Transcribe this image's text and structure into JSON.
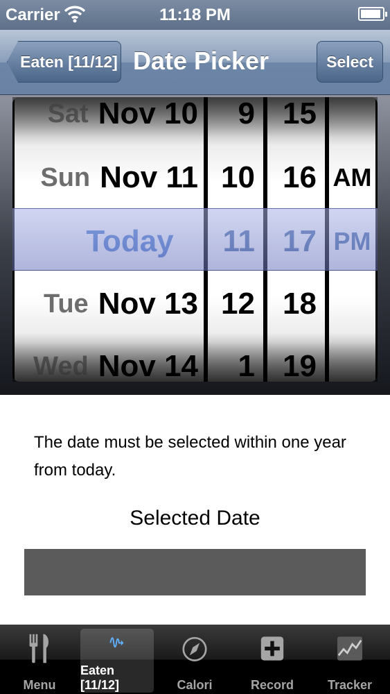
{
  "status": {
    "carrier": "Carrier",
    "time": "11:18 PM"
  },
  "nav": {
    "back_label": "Eaten [11/12]",
    "title": "Date Picker",
    "select_label": "Select"
  },
  "picker": {
    "date_rows": [
      {
        "dow": "Sat",
        "md": "Nov 10"
      },
      {
        "dow": "Sun",
        "md": "Nov 11"
      },
      {
        "today": "Today"
      },
      {
        "dow": "Tue",
        "md": "Nov 13"
      },
      {
        "dow": "Wed",
        "md": "Nov 14"
      }
    ],
    "hours": [
      "9",
      "10",
      "11",
      "12",
      "1"
    ],
    "minutes": [
      "15",
      "16",
      "17",
      "18",
      "19"
    ],
    "ampm": [
      "AM",
      "PM"
    ]
  },
  "content": {
    "info_line1": "The date must be selected within one year",
    "info_line2": "from today.",
    "selected_label": "Selected Date",
    "selected_value": ""
  },
  "tabs": [
    {
      "label": "Menu",
      "icon": "fork-knife-icon"
    },
    {
      "label": "Eaten [11/12]",
      "icon": "wave-arrow-icon",
      "active": true
    },
    {
      "label": "Calori",
      "icon": "compass-icon"
    },
    {
      "label": "Record",
      "icon": "plus-box-icon"
    },
    {
      "label": "Tracker",
      "icon": "graph-icon"
    }
  ],
  "colors": {
    "nav_top": "#b8c5d6",
    "nav_bottom": "#6a83a5",
    "selection_blue": "#4d7fd0",
    "selected_value_bg": "#5b5b5b"
  }
}
